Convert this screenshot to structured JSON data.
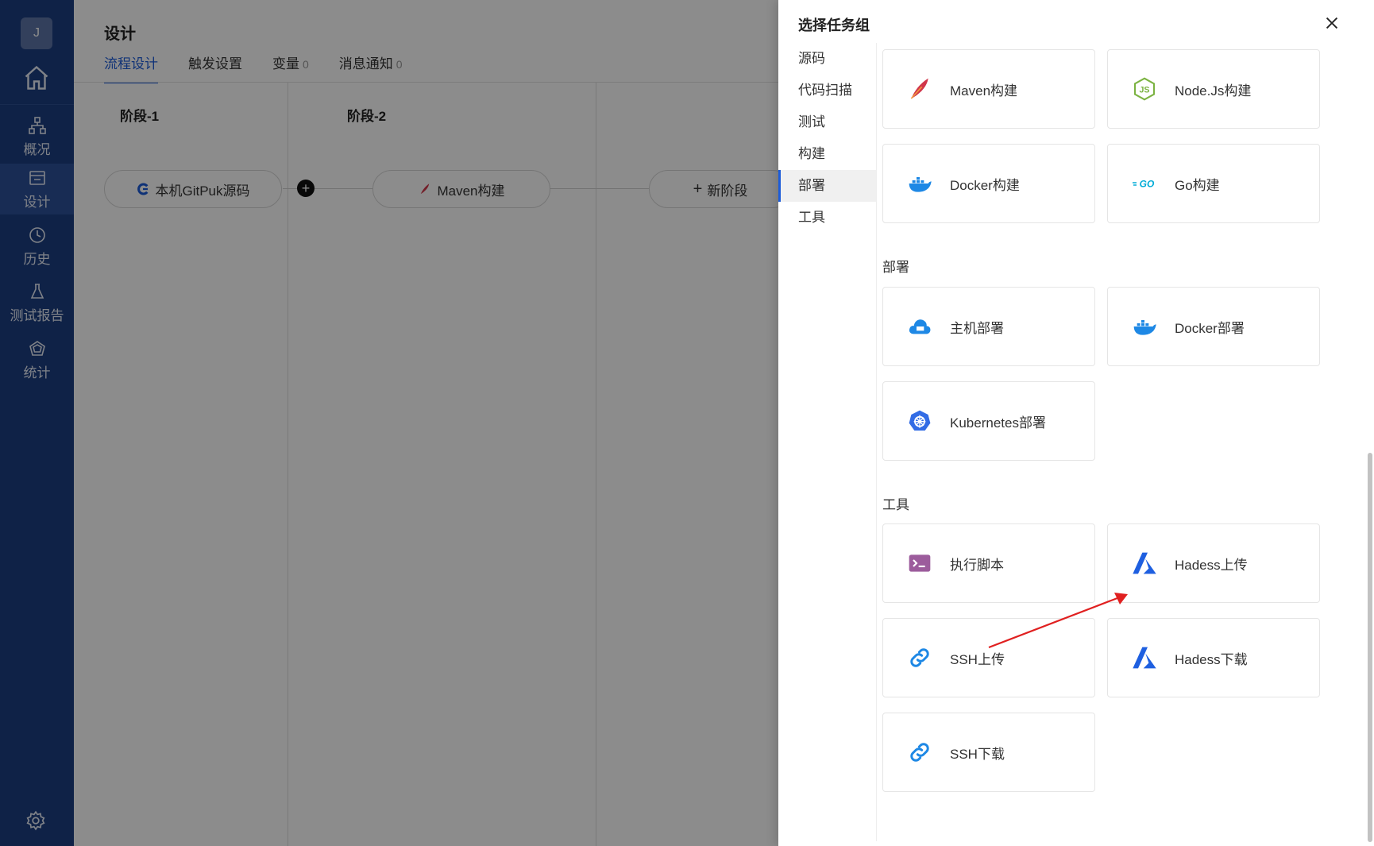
{
  "sidebar": {
    "avatar": "J",
    "items": [
      {
        "label": "概况",
        "icon": "overview-icon"
      },
      {
        "label": "设计",
        "icon": "design-icon"
      },
      {
        "label": "历史",
        "icon": "history-icon"
      },
      {
        "label": "测试报告",
        "icon": "test-report-icon"
      },
      {
        "label": "统计",
        "icon": "statistics-icon"
      }
    ]
  },
  "main": {
    "title": "设计",
    "tabs": [
      {
        "label": "流程设计",
        "count": ""
      },
      {
        "label": "触发设置",
        "count": ""
      },
      {
        "label": "变量",
        "count": "0"
      },
      {
        "label": "消息通知",
        "count": "0"
      }
    ],
    "stages": [
      {
        "title": "阶段-1",
        "task": "本机GitPuk源码"
      },
      {
        "title": "阶段-2",
        "task": "Maven构建"
      }
    ],
    "new_stage": "新阶段"
  },
  "drawer": {
    "title": "选择任务组",
    "categories": [
      "源码",
      "代码扫描",
      "测试",
      "构建",
      "部署",
      "工具"
    ],
    "active_category": "部署",
    "build": [
      {
        "label": "Maven构建",
        "icon": "maven-feather-icon"
      },
      {
        "label": "Node.Js构建",
        "icon": "nodejs-icon"
      },
      {
        "label": "Docker构建",
        "icon": "docker-icon"
      },
      {
        "label": "Go构建",
        "icon": "go-icon"
      }
    ],
    "deploy_title": "部署",
    "deploy": [
      {
        "label": "主机部署",
        "icon": "host-cloud-icon"
      },
      {
        "label": "Docker部署",
        "icon": "docker-icon"
      },
      {
        "label": "Kubernetes部署",
        "icon": "kubernetes-icon"
      }
    ],
    "tools_title": "工具",
    "tools": [
      {
        "label": "执行脚本",
        "icon": "terminal-icon"
      },
      {
        "label": "Hadess上传",
        "icon": "hadess-icon"
      },
      {
        "label": "SSH上传",
        "icon": "link-icon"
      },
      {
        "label": "Hadess下载",
        "icon": "hadess-icon"
      },
      {
        "label": "SSH下载",
        "icon": "link-icon"
      }
    ]
  },
  "colors": {
    "sidebar": "#1d3f82",
    "accent": "#1c5cd9",
    "annotation_arrow": "#e02020"
  }
}
